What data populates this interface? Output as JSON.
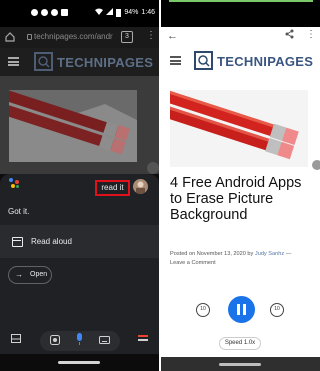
{
  "left": {
    "status": {
      "battery": "94%",
      "time": "1:46"
    },
    "browser": {
      "url": "technipages.com/andr",
      "tab_count": "3"
    },
    "site": {
      "logo": "TECHNIPAGES"
    },
    "assistant": {
      "read_it_chip": "read it",
      "response": "Got it.",
      "card_label": "Read aloud",
      "open_button": "Open"
    }
  },
  "right": {
    "site": {
      "logo": "TECHNIPAGES"
    },
    "article": {
      "title": "4 Free Android Apps to Erase Picture Background",
      "posted": "Posted on November 13, 2020 by ",
      "author": "Judy Sanhz",
      "separator": " —",
      "comment": "Leave a Comment"
    },
    "player": {
      "rewind": "10",
      "forward": "10",
      "speed": "Speed 1.0x"
    }
  },
  "colors": {
    "highlight_box": "#e0101c",
    "play_button": "#1a73e8",
    "logo_blue": "#3a5580"
  }
}
